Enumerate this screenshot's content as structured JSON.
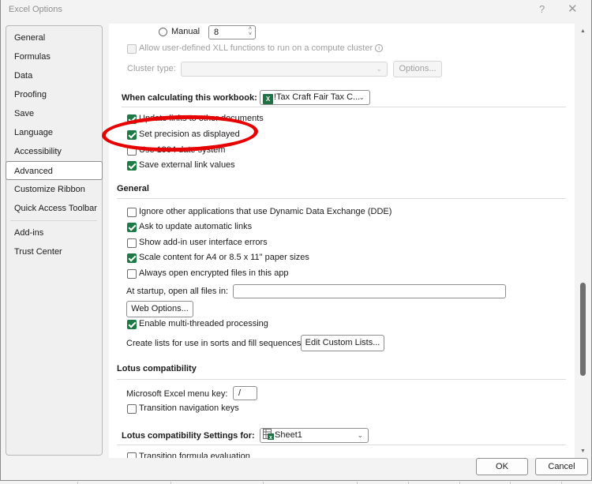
{
  "window": {
    "title": "Excel Options",
    "help_label": "?",
    "close_label": "✕"
  },
  "sidebar": {
    "items": [
      {
        "label": "General",
        "active": false
      },
      {
        "label": "Formulas",
        "active": false
      },
      {
        "label": "Data",
        "active": false
      },
      {
        "label": "Proofing",
        "active": false
      },
      {
        "label": "Save",
        "active": false
      },
      {
        "label": "Language",
        "active": false
      },
      {
        "label": "Accessibility",
        "active": false
      },
      {
        "label": "Advanced",
        "active": true
      },
      {
        "label": "Customize Ribbon",
        "active": false
      },
      {
        "label": "Quick Access Toolbar",
        "active": false
      },
      {
        "label": "Add-ins",
        "active": false
      },
      {
        "label": "Trust Center",
        "active": false
      }
    ]
  },
  "formulas_top": {
    "manual_radio_label": "Manual",
    "manual_selected": false,
    "threads_value": "8",
    "allow_xll_label": "Allow user-defined XLL functions to run on a compute cluster",
    "allow_xll_checked": false,
    "cluster_type_label": "Cluster type:",
    "cluster_type_value": "",
    "options_button": "Options..."
  },
  "when_calculating": {
    "heading": "When calculating this workbook:",
    "workbook_value": "!Tax Craft Fair Tax C...",
    "workbook_icon": "excel-icon",
    "options": [
      {
        "label": "Update links to other documents",
        "checked": true
      },
      {
        "label": "Set precision as displayed",
        "checked": true,
        "highlighted": true
      },
      {
        "label": "Use 1904 date system",
        "checked": false
      },
      {
        "label": "Save external link values",
        "checked": true
      }
    ]
  },
  "general": {
    "heading": "General",
    "options": [
      {
        "label": "Ignore other applications that use Dynamic Data Exchange (DDE)",
        "checked": false
      },
      {
        "label": "Ask to update automatic links",
        "checked": true
      },
      {
        "label": "Show add-in user interface errors",
        "checked": false
      },
      {
        "label": "Scale content for A4 or 8.5 x 11\" paper sizes",
        "checked": true
      },
      {
        "label": "Always open encrypted files in this app",
        "checked": false
      }
    ],
    "startup_label": "At startup, open all files in:",
    "startup_value": "",
    "web_options_button": "Web Options...",
    "multithread_label": "Enable multi-threaded processing",
    "multithread_checked": true,
    "custom_lists_label": "Create lists for use in sorts and fill sequences:",
    "custom_lists_button": "Edit Custom Lists..."
  },
  "lotus": {
    "heading": "Lotus compatibility",
    "menu_key_label": "Microsoft Excel menu key:",
    "menu_key_value": "/",
    "transition_nav_label": "Transition navigation keys",
    "transition_nav_checked": false
  },
  "lotus_settings": {
    "heading": "Lotus compatibility Settings for:",
    "sheet_value": "Sheet1",
    "sheet_icon": "sheet-icon",
    "partial_option_label": "Transition formula evaluation",
    "partial_option_checked": false
  },
  "scroll": {
    "position_fraction": 0.78
  },
  "footer": {
    "ok": "OK",
    "cancel": "Cancel"
  },
  "annotation": {
    "color": "#e60000",
    "target": "Set precision as displayed"
  }
}
